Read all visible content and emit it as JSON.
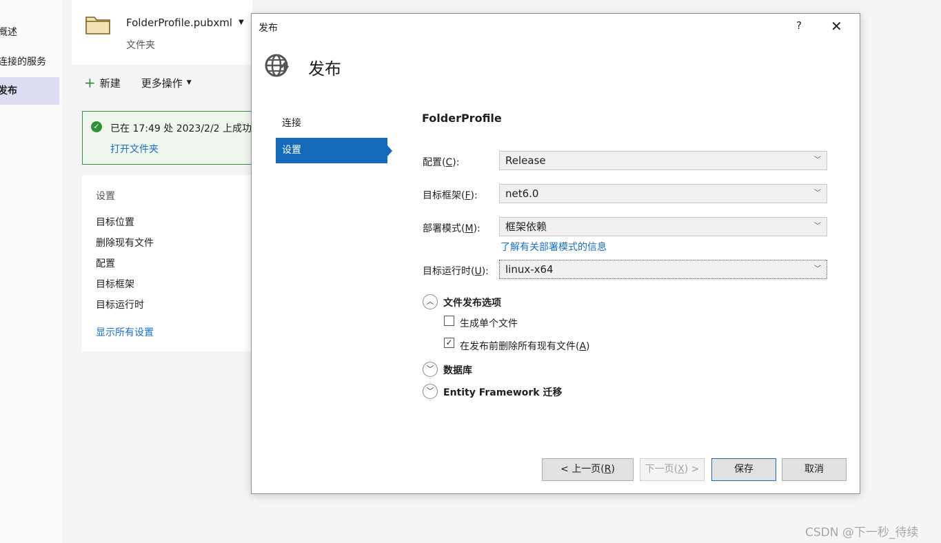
{
  "left_nav": {
    "items": [
      {
        "label": "概述"
      },
      {
        "label": "连接的服务"
      },
      {
        "label": "发布",
        "active": true
      }
    ]
  },
  "profile": {
    "name": "FolderProfile.pubxml",
    "type": "文件夹"
  },
  "toolbar": {
    "new_label": "新建",
    "more_label": "更多操作"
  },
  "notice": {
    "text": "已在 17:49 处 2023/2/2 上成功",
    "link": "打开文件夹"
  },
  "settings_card": {
    "title": "设置",
    "items": [
      "目标位置",
      "删除现有文件",
      "配置",
      "目标框架",
      "目标运行时"
    ],
    "show_all": "显示所有设置"
  },
  "dialog": {
    "title": "发布",
    "help": "?",
    "heading": "发布",
    "nav": [
      {
        "label": "连接"
      },
      {
        "label": "设置",
        "active": true
      }
    ],
    "form_title": "FolderProfile",
    "fields": [
      {
        "label_pre": "配置(",
        "accel": "C",
        "label_post": "):",
        "value": "Release"
      },
      {
        "label_pre": "目标框架(",
        "accel": "F",
        "label_post": "):",
        "value": "net6.0"
      },
      {
        "label_pre": "部署模式(",
        "accel": "M",
        "label_post": "):",
        "value": "框架依赖"
      },
      {
        "label_pre": "目标运行时(",
        "accel": "U",
        "label_post": "):",
        "value": "linux-x64"
      }
    ],
    "learn_link": "了解有关部署模式的信息",
    "sections": {
      "file_publish": {
        "label": "文件发布选项",
        "expanded": true,
        "options": [
          {
            "label": "生成单个文件",
            "checked": false
          },
          {
            "label_pre": "在发布前删除所有现有文件(",
            "accel": "A",
            "label_post": ")",
            "checked": true
          }
        ]
      },
      "database": {
        "label": "数据库",
        "expanded": false
      },
      "ef": {
        "label": "Entity Framework 迁移",
        "expanded": false
      }
    },
    "buttons": {
      "prev_pre": "< 上一页(",
      "prev_accel": "R",
      "prev_post": ")",
      "next_pre": "下一页(",
      "next_accel": "X",
      "next_post": ") >",
      "save": "保存",
      "cancel": "取消"
    }
  },
  "watermark": "CSDN @下一秒_待续",
  "colors": {
    "accent": "#1469b8",
    "success": "#2f8f3a",
    "link": "#1a6fc0"
  }
}
